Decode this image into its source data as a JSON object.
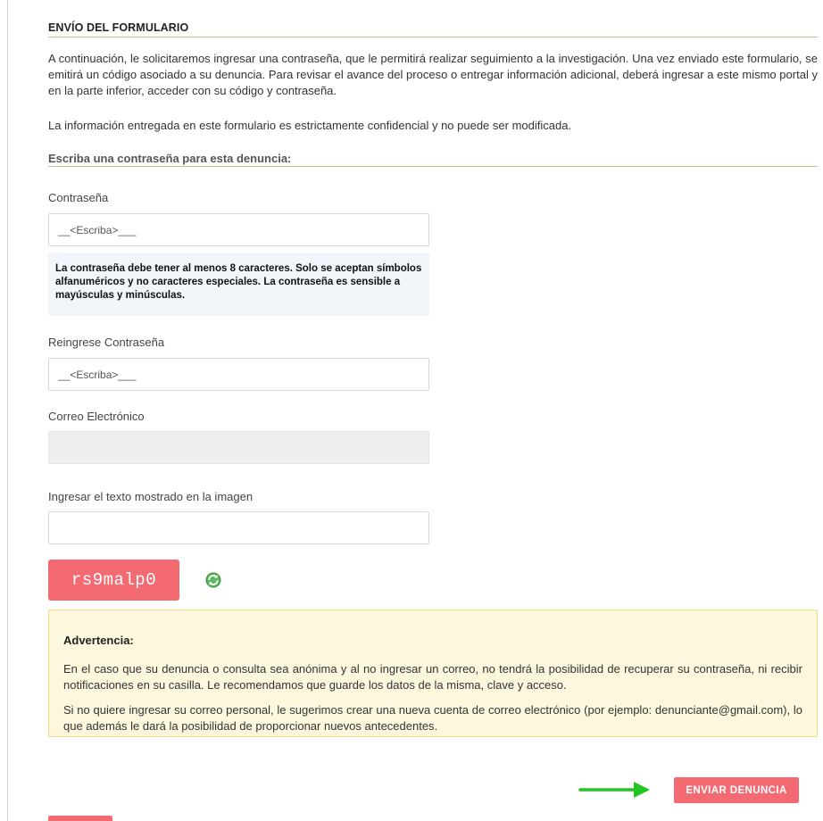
{
  "form": {
    "section_title": "ENVÍO DEL FORMULARIO",
    "intro_text": "A continuación, le solicitaremos ingresar una contraseña, que le permitirá realizar seguimiento a la investigación. Una vez enviado este formulario, se emitirá un código asociado a su denuncia. Para revisar el avance del proceso o entregar información adicional, deberá ingresar a este mismo portal y en la parte inferior, acceder con su código y contraseña.",
    "confidential_text": "La información entregada en este formulario es estrictamente confidencial y no puede ser modificada.",
    "password_subhead": "Escriba una contraseña para esta denuncia:",
    "password": {
      "label": "Contraseña",
      "placeholder": "__<Escriba>___",
      "value": ""
    },
    "password_hint": "La contraseña debe tener al menos 8 caracteres. Solo se aceptan símbolos alfanuméricos y no caracteres especiales. La contraseña es sensible a mayúsculas y minúsculas.",
    "password_confirm": {
      "label": "Reingrese Contraseña",
      "placeholder": "__<Escriba>___",
      "value": ""
    },
    "email": {
      "label": "Correo Electrónico",
      "value": ""
    },
    "captcha_input": {
      "label": "Ingresar el texto mostrado en la imagen",
      "value": ""
    },
    "captcha_text": "rs9malp0",
    "refresh_icon": "refresh-icon"
  },
  "warning": {
    "title": "Advertencia:",
    "paragraph_1": "En el caso que su denuncia o consulta sea anónima y al no ingresar un correo, no tendrá la posibilidad de recuperar su contraseña, ni recibir notificaciones en su casilla. Le recomendamos que guarde los datos de la misma, clave y acceso.",
    "paragraph_2": "Si no quiere ingresar su correo personal, le sugerimos crear una nueva cuenta de correo electrónico (por ejemplo: denunciante@gmail.com), lo que además le dará la posibilidad de proporcionar nuevos antecedentes."
  },
  "actions": {
    "submit_label": "ENVIAR DENUNCIA"
  },
  "colors": {
    "accent": "#f46a73",
    "warning_bg": "#fdf8dd",
    "warning_border": "#f1dc82",
    "hint_bg": "#f2f6fa",
    "arrow": "#22c522",
    "section_rule": "#cdbf94"
  }
}
